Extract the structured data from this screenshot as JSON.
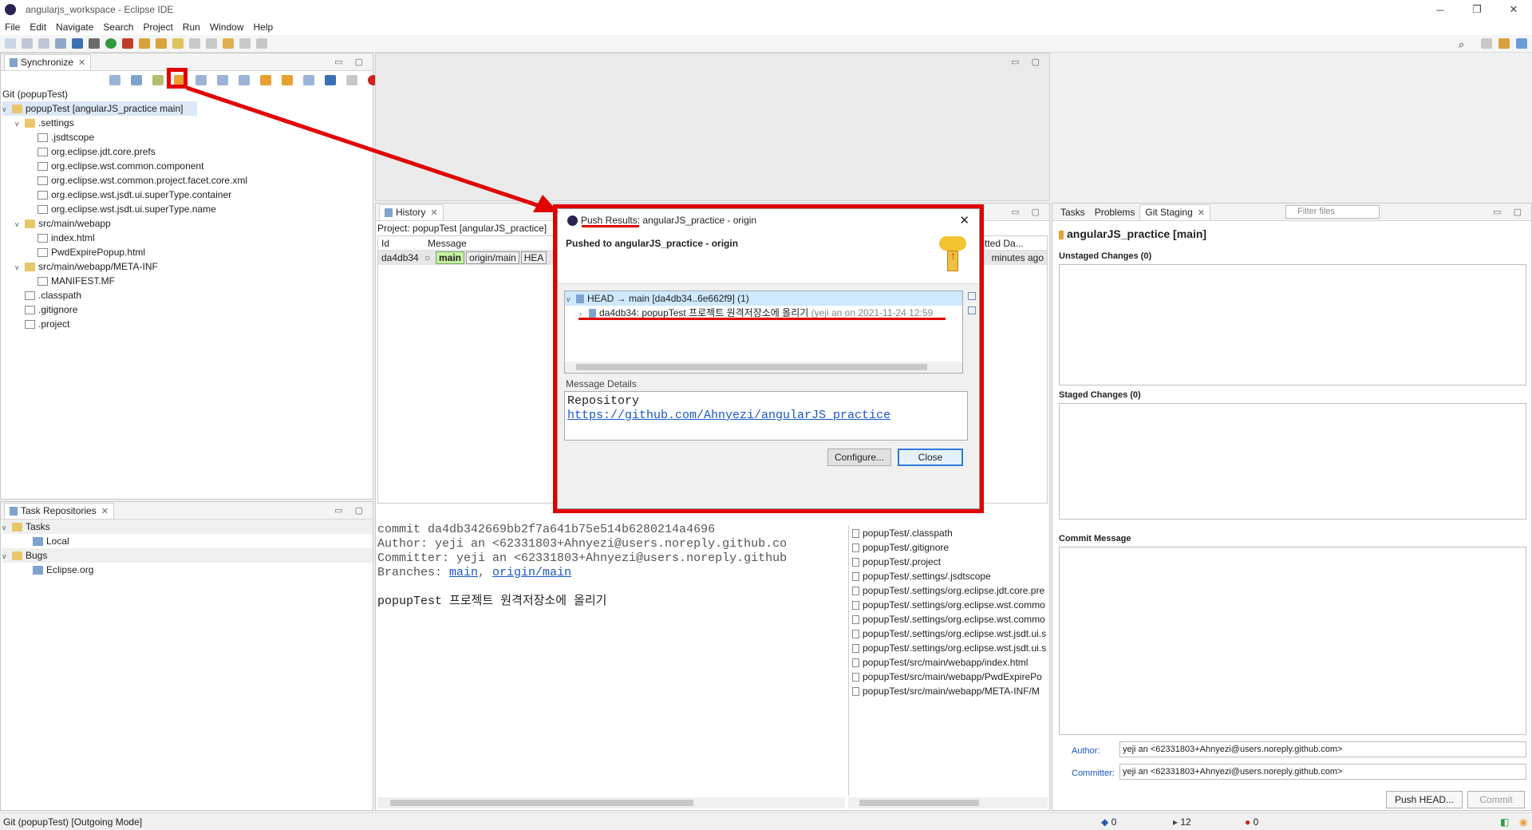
{
  "window": {
    "title": "angularjs_workspace - Eclipse IDE",
    "controls": [
      "─",
      "❐",
      "✕"
    ]
  },
  "menu": [
    "File",
    "Edit",
    "Navigate",
    "Search",
    "Project",
    "Run",
    "Window",
    "Help"
  ],
  "sync": {
    "tab": "Synchronize",
    "root_label": "Git (popupTest)",
    "project": "popupTest [angularJS_practice main]",
    "tree": [
      {
        "label": ".settings",
        "type": "folder",
        "depth": 1,
        "chev": "v"
      },
      {
        "label": ".jsdtscope",
        "type": "file",
        "depth": 2
      },
      {
        "label": "org.eclipse.jdt.core.prefs",
        "type": "file",
        "depth": 2
      },
      {
        "label": "org.eclipse.wst.common.component",
        "type": "file",
        "depth": 2
      },
      {
        "label": "org.eclipse.wst.common.project.facet.core.xml",
        "type": "file",
        "depth": 2
      },
      {
        "label": "org.eclipse.wst.jsdt.ui.superType.container",
        "type": "file",
        "depth": 2
      },
      {
        "label": "org.eclipse.wst.jsdt.ui.superType.name",
        "type": "file",
        "depth": 2
      },
      {
        "label": "src/main/webapp",
        "type": "folder",
        "depth": 1,
        "chev": "v"
      },
      {
        "label": "index.html",
        "type": "file",
        "depth": 2
      },
      {
        "label": "PwdExpirePopup.html",
        "type": "file",
        "depth": 2
      },
      {
        "label": "src/main/webapp/META-INF",
        "type": "folder",
        "depth": 1,
        "chev": "v"
      },
      {
        "label": "MANIFEST.MF",
        "type": "file",
        "depth": 2
      },
      {
        "label": ".classpath",
        "type": "file",
        "depth": 1
      },
      {
        "label": ".gitignore",
        "type": "file",
        "depth": 1
      },
      {
        "label": ".project",
        "type": "file",
        "depth": 1
      }
    ]
  },
  "taskrepo": {
    "tab": "Task Repositories",
    "items": [
      {
        "label": "Tasks",
        "depth": 0,
        "chev": "v"
      },
      {
        "label": "Local",
        "depth": 1
      },
      {
        "label": "Bugs",
        "depth": 0,
        "chev": "v"
      },
      {
        "label": "Eclipse.org",
        "depth": 1
      }
    ]
  },
  "history": {
    "tab": "History",
    "project": "Project: popupTest [angularJS_practice]",
    "col_id": "Id",
    "col_message": "Message",
    "col_committed": "Committed Da...",
    "row": {
      "id": "da4db34",
      "ref1": "main",
      "ref2": "origin/main",
      "ref3": "HEA",
      "time": "minutes ago"
    },
    "commit_lines": [
      "commit da4db342669bb2f7a641b75e514b6280214a4696",
      "Author: yeji an <62331803+Ahnyezi@users.noreply.github.co",
      "Committer: yeji an <62331803+Ahnyezi@users.noreply.github"
    ],
    "branches_label": "Branches: ",
    "branch1": "main",
    "branch2": "origin/main",
    "commit_msg": "popupTest 프로젝트 원격저장소에 올리기",
    "files": [
      "popupTest/.classpath",
      "popupTest/.gitignore",
      "popupTest/.project",
      "popupTest/.settings/.jsdtscope",
      "popupTest/.settings/org.eclipse.jdt.core.pre",
      "popupTest/.settings/org.eclipse.wst.commo",
      "popupTest/.settings/org.eclipse.wst.commo",
      "popupTest/.settings/org.eclipse.wst.jsdt.ui.s",
      "popupTest/.settings/org.eclipse.wst.jsdt.ui.s",
      "popupTest/src/main/webapp/index.html",
      "popupTest/src/main/webapp/PwdExpirePo",
      "popupTest/src/main/webapp/META-INF/M"
    ]
  },
  "staging": {
    "tabs": [
      "Tasks",
      "Problems",
      "Git Staging"
    ],
    "filter_placeholder": "Filter files",
    "repo": "angularJS_practice [main]",
    "unstaged": "Unstaged Changes (0)",
    "staged": "Staged Changes (0)",
    "commit_message": "Commit Message",
    "author_label": "Author:",
    "author_value": "yeji an <62331803+Ahnyezi@users.noreply.github.com>",
    "committer_label": "Committer:",
    "committer_value": "yeji an <62331803+Ahnyezi@users.noreply.github.com>",
    "push_btn": "Push HEAD...",
    "commit_btn": "Commit"
  },
  "dialog": {
    "title": "Push Results: angularJS_practice - origin",
    "heading": "Pushed to angularJS_practice - origin",
    "tree_head": "HEAD → main [da4db34..6e662f9] (1)",
    "tree_commit": "da4db34: popupTest 프로젝트 원격저장소에 올리기",
    "tree_commit_meta": "(yeji an on 2021-11-24 12:59",
    "details_label": "Message Details",
    "details_line1": "Repository",
    "details_link": "https://github.com/Ahnyezi/angularJS_practice",
    "configure_btn": "Configure...",
    "close_btn": "Close"
  },
  "status": {
    "left": "Git (popupTest) [Outgoing Mode]",
    "count1": "0",
    "count2": "12",
    "count3": "0"
  },
  "colors": {
    "annotation": "#e10000",
    "link": "#1a57c8",
    "selection": "#cde8ff"
  }
}
